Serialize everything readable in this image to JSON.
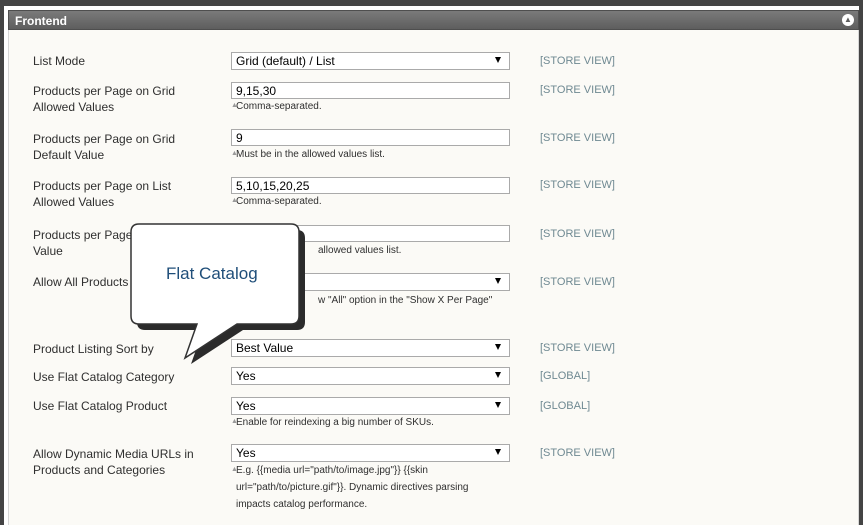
{
  "panel": {
    "title": "Frontend"
  },
  "rows": {
    "list_mode": {
      "label": "List Mode",
      "value": "Grid (default) / List",
      "scope": "[STORE VIEW]"
    },
    "grid_allowed": {
      "label1": "Products per Page on Grid",
      "label2": "Allowed Values",
      "value": "9,15,30",
      "note": "Comma-separated.",
      "scope": "[STORE VIEW]"
    },
    "grid_default": {
      "label1": "Products per Page on Grid",
      "label2": "Default Value",
      "value": "9",
      "note": "Must be in the allowed values list.",
      "scope": "[STORE VIEW]"
    },
    "list_allowed": {
      "label1": "Products per Page on List",
      "label2": "Allowed Values",
      "value": "5,10,15,20,25",
      "note": "Comma-separated.",
      "scope": "[STORE VIEW]"
    },
    "list_default": {
      "label1": "Products per Page",
      "label2": "Value",
      "note": "allowed values list.",
      "scope": "[STORE VIEW]"
    },
    "allow_all": {
      "label": "Allow All Products",
      "note": "w \"All\" option in the \"Show X Per Page\"",
      "scope": "[STORE VIEW]"
    },
    "sort_by": {
      "label": "Product Listing Sort by",
      "value": "Best Value",
      "scope": "[STORE VIEW]"
    },
    "flat_category": {
      "label": "Use Flat Catalog Category",
      "value": "Yes",
      "scope": "[GLOBAL]"
    },
    "flat_product": {
      "label": "Use Flat Catalog Product",
      "value": "Yes",
      "note": "Enable for reindexing a big number of SKUs.",
      "scope": "[GLOBAL]"
    },
    "dynamic_media": {
      "label1": "Allow Dynamic Media URLs in",
      "label2": "Products and Categories",
      "value": "Yes",
      "note1": "E.g. {{media url=\"path/to/image.jpg\"}} {{skin",
      "note2": "url=\"path/to/picture.gif\"}}. Dynamic directives parsing",
      "note3": "impacts catalog performance.",
      "scope": "[STORE VIEW]"
    }
  },
  "callout": {
    "text": "Flat Catalog"
  }
}
